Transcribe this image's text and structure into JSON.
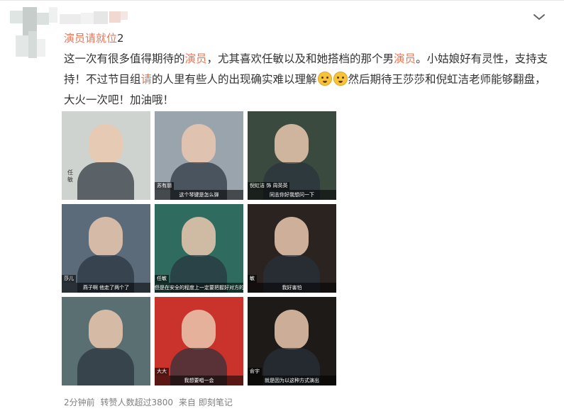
{
  "post": {
    "repost_source": {
      "name": "演员请就位",
      "suffix": "2"
    },
    "text_segments": [
      {
        "t": "这一次有很多值得期待的",
        "hl": false
      },
      {
        "t": "演员",
        "hl": true
      },
      {
        "t": "，尤其喜欢任敏以及和她搭档的那个男",
        "hl": false
      },
      {
        "t": "演员",
        "hl": true
      },
      {
        "t": "。小姑娘好有灵性，支持支持！不过节目组",
        "hl": false
      },
      {
        "t": "请",
        "hl": true
      },
      {
        "t": "的人里有些人的出现确实难以理解",
        "hl": false
      },
      {
        "t": "",
        "hl": false,
        "emoji": "face-emoji"
      },
      {
        "t": "",
        "hl": false,
        "emoji": "face-emoji"
      },
      {
        "t": "然后期待王莎莎和倪虹洁老师能够翻盘，大火一次吧！加油哦！",
        "hl": false
      }
    ],
    "images": [
      {
        "bg": "#cfd3cf",
        "tag": "",
        "caption": "",
        "side_text": "任敏"
      },
      {
        "bg": "#9aa4ad",
        "tag": "苏有朋",
        "caption": "这个琴键是怎么弹",
        "side_text": ""
      },
      {
        "bg": "#3a4a3e",
        "tag": "倪虹洁 饰 周英英",
        "caption": "同志你好我想问一下",
        "side_text": ""
      },
      {
        "bg": "#5b6b7a",
        "tag": "莎儿",
        "caption": "燕子啊 他走了两个了",
        "side_text": ""
      },
      {
        "bg": "#2f6b5e",
        "tag": "任敏",
        "caption": "但是在安全的程度上一定要把握好对方的距离",
        "side_text": ""
      },
      {
        "bg": "#2a2320",
        "tag": "敏",
        "caption": "我好害怕",
        "side_text": ""
      },
      {
        "bg": "#5a6f72",
        "tag": "",
        "caption": "",
        "side_text": ""
      },
      {
        "bg": "#c9332c",
        "tag": "大大",
        "caption": "我想要唱一会",
        "side_text": ""
      },
      {
        "bg": "#1e1a18",
        "tag": "俞宇",
        "caption": "就是因为以这种方式演出",
        "side_text": ""
      }
    ],
    "footer": {
      "time": "2分钟前",
      "reposts": "转赞人数超过3800",
      "source_prefix": "来自",
      "source": "即刻笔记"
    }
  },
  "colors": {
    "link": "#eb7350",
    "text": "#333333",
    "meta": "#808080"
  },
  "icons": {
    "menu": "chevron-down-icon",
    "emoji": "face-emoji"
  }
}
